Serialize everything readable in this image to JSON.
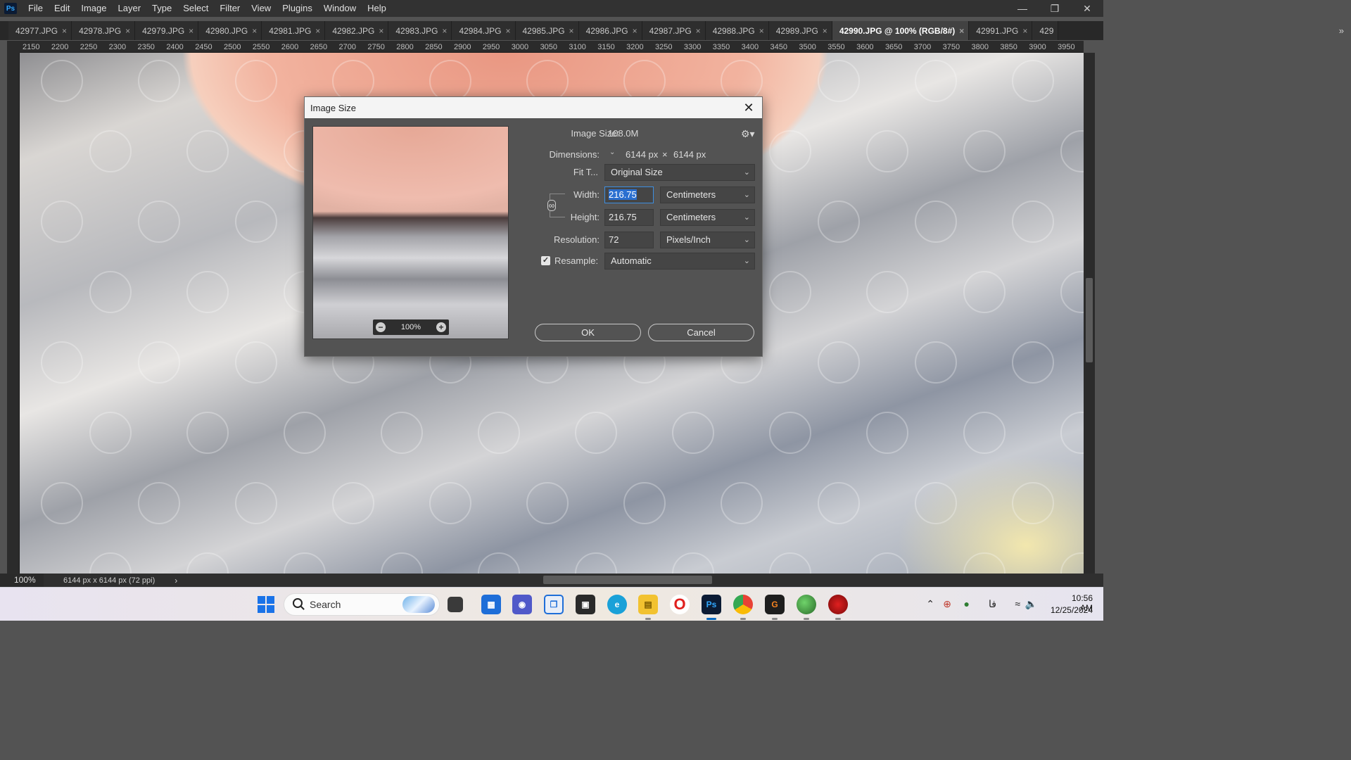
{
  "app": {
    "logo": "Ps",
    "menu": [
      "File",
      "Edit",
      "Image",
      "Layer",
      "Type",
      "Select",
      "Filter",
      "View",
      "Plugins",
      "Window",
      "Help"
    ]
  },
  "tabs": [
    {
      "label": "42977.JPG",
      "active": false
    },
    {
      "label": "42978.JPG",
      "active": false
    },
    {
      "label": "42979.JPG",
      "active": false
    },
    {
      "label": "42980.JPG",
      "active": false
    },
    {
      "label": "42981.JPG",
      "active": false
    },
    {
      "label": "42982.JPG",
      "active": false
    },
    {
      "label": "42983.JPG",
      "active": false
    },
    {
      "label": "42984.JPG",
      "active": false
    },
    {
      "label": "42985.JPG",
      "active": false
    },
    {
      "label": "42986.JPG",
      "active": false
    },
    {
      "label": "42987.JPG",
      "active": false
    },
    {
      "label": "42988.JPG",
      "active": false
    },
    {
      "label": "42989.JPG",
      "active": false
    },
    {
      "label": "42990.JPG @ 100% (RGB/8#)",
      "active": true
    },
    {
      "label": "42991.JPG",
      "active": false
    },
    {
      "label": "429",
      "active": false
    }
  ],
  "tab_overflow_icon": "double-chevron-right",
  "ruler": {
    "horizontal": [
      "2150",
      "2200",
      "2250",
      "2300",
      "2350",
      "2400",
      "2450",
      "2500",
      "2550",
      "2600",
      "2650",
      "2700",
      "2750",
      "2800",
      "2850",
      "2900",
      "2950",
      "3000",
      "3050",
      "3100",
      "3150",
      "3200",
      "3250",
      "3300",
      "3350",
      "3400",
      "3450",
      "3500",
      "3550",
      "3600",
      "3650",
      "3700",
      "3750",
      "3800",
      "3850",
      "3900",
      "3950"
    ]
  },
  "status": {
    "zoom": "100%",
    "doc_info": "6144 px x 6144 px (72 ppi)",
    "arrow": "›"
  },
  "dialog": {
    "title": "Image Size",
    "image_size_label": "Image Size:",
    "image_size_value": "108.0M",
    "dimensions_label": "Dimensions:",
    "dimensions_width": "6144 px",
    "dimensions_x": "×",
    "dimensions_height": "6144 px",
    "fit_to_label": "Fit T...",
    "fit_to_value": "Original Size",
    "width_label": "Width:",
    "width_value": "216.75",
    "width_unit": "Centimeters",
    "height_label": "Height:",
    "height_value": "216.75",
    "height_unit": "Centimeters",
    "resolution_label": "Resolution:",
    "resolution_value": "72",
    "resolution_unit": "Pixels/Inch",
    "resample_label": "Resample:",
    "resample_checked": true,
    "resample_value": "Automatic",
    "preview_zoom": "100%",
    "ok_label": "OK",
    "cancel_label": "Cancel"
  },
  "taskbar": {
    "search_label": "Search",
    "apps": [
      "task-view",
      "widgets",
      "teams-meet",
      "snipping-tool",
      "microsoft-store",
      "edge",
      "file-explorer",
      "opera",
      "photoshop",
      "chrome",
      "g-app",
      "earth-app",
      "red-app"
    ],
    "tray_lang": "فا",
    "clock_time": "10:56 AM",
    "clock_date": "12/25/2024"
  }
}
